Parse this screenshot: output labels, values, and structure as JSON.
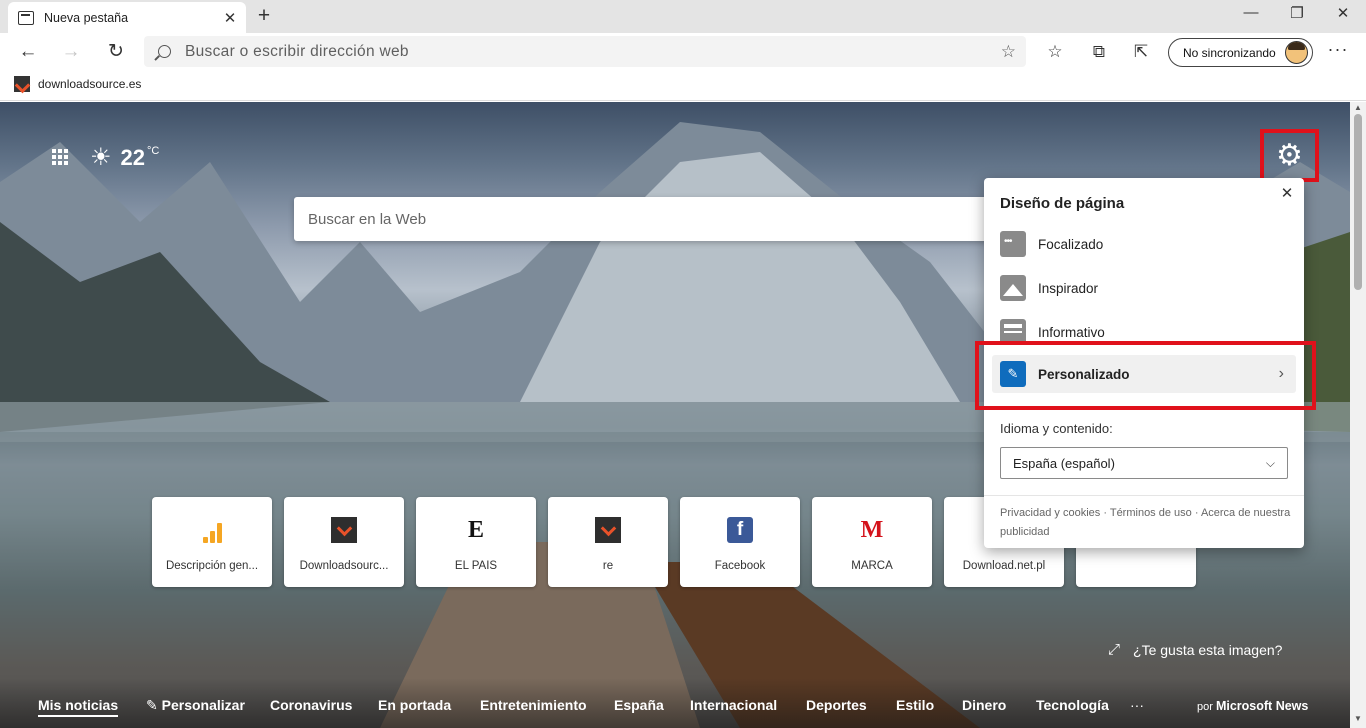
{
  "browser": {
    "tab_title": "Nueva pestaña",
    "tab_close": "✕",
    "new_tab": "+",
    "window_controls": {
      "minimize": "—",
      "restore": "❐",
      "close": "✕"
    },
    "address_placeholder": "Buscar o escribir dirección web",
    "profile_label": "No sincronizando",
    "more_menu": "···",
    "bookmark_label": "downloadsource.es",
    "icons": [
      "back-icon",
      "forward-icon",
      "refresh-icon",
      "search-icon",
      "favorite-star-icon",
      "favorites-icon",
      "collections-icon",
      "share-icon",
      "more-icon"
    ]
  },
  "ntp": {
    "temperature": "22",
    "temp_unit": "°C",
    "weather_icon": "☀",
    "search_placeholder": "Buscar en la Web",
    "settings_icon": "⚙",
    "tiles": [
      {
        "label": "Descripción gen...",
        "icon": "analytics"
      },
      {
        "label": "Downloadsourc...",
        "icon": "downloadsource"
      },
      {
        "label": "EL PAÍS",
        "icon": "E"
      },
      {
        "label": "re",
        "icon": "downloadsource"
      },
      {
        "label": "Facebook",
        "icon": "f"
      },
      {
        "label": "MARCA",
        "icon": "M"
      },
      {
        "label": "Download.net.pl",
        "icon": ""
      }
    ],
    "like_image": "¿Te gusta esta imagen?",
    "news_nav": [
      "Mis noticias",
      "Personalizar",
      "Coronavirus",
      "En portada",
      "Entretenimiento",
      "España",
      "Internacional",
      "Deportes",
      "Estilo",
      "Dinero",
      "Tecnología",
      "···"
    ],
    "powered_by_prefix": "por",
    "powered_by_brand": "Microsoft News"
  },
  "flyout": {
    "close": "✕",
    "title": "Diseño de página",
    "options": [
      {
        "label": "Focalizado",
        "icon": "focused-layout-icon"
      },
      {
        "label": "Inspirador",
        "icon": "inspirational-layout-icon"
      },
      {
        "label": "Informativo",
        "icon": "informational-layout-icon"
      },
      {
        "label": "Personalizado",
        "icon": "custom-layout-icon",
        "selected": true
      }
    ],
    "chevron": "›",
    "language_label": "Idioma y contenido:",
    "language_value": "España (español)",
    "footer": "Privacidad y cookies · Términos de uso · Acerca de nuestra publicidad"
  },
  "colors": {
    "highlight": "#e0111b",
    "accent": "#0f6cbd"
  }
}
